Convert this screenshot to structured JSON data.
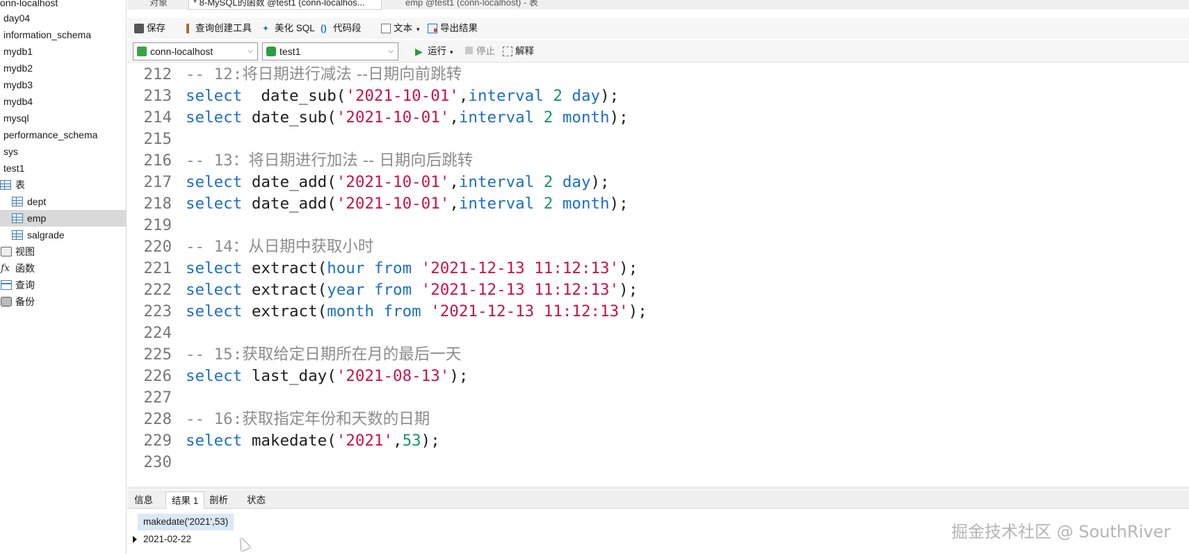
{
  "sidebar": {
    "items": [
      {
        "label": "onn-localhost"
      },
      {
        "label": "day04"
      },
      {
        "label": "information_schema"
      },
      {
        "label": "mydb1"
      },
      {
        "label": "mydb2"
      },
      {
        "label": "mydb3"
      },
      {
        "label": "mydb4"
      },
      {
        "label": "mysql"
      },
      {
        "label": "performance_schema"
      },
      {
        "label": "sys"
      },
      {
        "label": "test1"
      },
      {
        "label": "表"
      },
      {
        "label": "dept"
      },
      {
        "label": "emp"
      },
      {
        "label": "salgrade"
      },
      {
        "label": "视图"
      },
      {
        "label": "函数"
      },
      {
        "label": "查询"
      },
      {
        "label": "备份"
      }
    ]
  },
  "tabs": [
    {
      "label": "对象"
    },
    {
      "label": "* 8-MySQL的函数 @test1 (conn-localhos..."
    },
    {
      "label": "emp @test1 (conn-localhost) - 表"
    }
  ],
  "toolbar": {
    "save": "保存",
    "query_builder": "查询创建工具",
    "beautify": "美化 SQL",
    "snippet": "代码段",
    "text": "文本",
    "export": "导出结果"
  },
  "connbar": {
    "connection": "conn-localhost",
    "database": "test1",
    "run": "运行",
    "stop": "停止",
    "explain": "解释"
  },
  "editor": {
    "lines": [
      {
        "n": "212",
        "parts": [
          [
            "cm",
            "-- 12:"
          ],
          [
            "cmcn",
            "将日期进行减法 --日期向前跳转"
          ]
        ]
      },
      {
        "n": "213",
        "parts": [
          [
            "kw",
            "select"
          ],
          [
            "",
            "  date_sub("
          ],
          [
            "str",
            "'2021-10-01'"
          ],
          [
            "",
            ","
          ],
          [
            "kw",
            "interval"
          ],
          [
            "",
            " "
          ],
          [
            "num",
            "2"
          ],
          [
            "",
            " "
          ],
          [
            "kw",
            "day"
          ],
          [
            "",
            ");"
          ]
        ]
      },
      {
        "n": "214",
        "parts": [
          [
            "kw",
            "select"
          ],
          [
            "",
            " date_sub("
          ],
          [
            "str",
            "'2021-10-01'"
          ],
          [
            "",
            ","
          ],
          [
            "kw",
            "interval"
          ],
          [
            "",
            " "
          ],
          [
            "num",
            "2"
          ],
          [
            "",
            " "
          ],
          [
            "kw",
            "month"
          ],
          [
            "",
            ");"
          ]
        ]
      },
      {
        "n": "215",
        "parts": []
      },
      {
        "n": "216",
        "parts": [
          [
            "cm",
            "-- 13："
          ],
          [
            "cmcn",
            "将日期进行加法 -- 日期向后跳转"
          ]
        ]
      },
      {
        "n": "217",
        "parts": [
          [
            "kw",
            "select"
          ],
          [
            "",
            " date_add("
          ],
          [
            "str",
            "'2021-10-01'"
          ],
          [
            "",
            ","
          ],
          [
            "kw",
            "interval"
          ],
          [
            "",
            " "
          ],
          [
            "num",
            "2"
          ],
          [
            "",
            " "
          ],
          [
            "kw",
            "day"
          ],
          [
            "",
            ");"
          ]
        ]
      },
      {
        "n": "218",
        "parts": [
          [
            "kw",
            "select"
          ],
          [
            "",
            " date_add("
          ],
          [
            "str",
            "'2021-10-01'"
          ],
          [
            "",
            ","
          ],
          [
            "kw",
            "interval"
          ],
          [
            "",
            " "
          ],
          [
            "num",
            "2"
          ],
          [
            "",
            " "
          ],
          [
            "kw",
            "month"
          ],
          [
            "",
            ");"
          ]
        ]
      },
      {
        "n": "219",
        "parts": []
      },
      {
        "n": "220",
        "parts": [
          [
            "cm",
            "-- 14："
          ],
          [
            "cmcn",
            "从日期中获取小时"
          ]
        ]
      },
      {
        "n": "221",
        "parts": [
          [
            "kw",
            "select"
          ],
          [
            "",
            " extract("
          ],
          [
            "kw",
            "hour"
          ],
          [
            "",
            " "
          ],
          [
            "kw",
            "from"
          ],
          [
            "",
            " "
          ],
          [
            "str",
            "'2021-12-13 11:12:13'"
          ],
          [
            "",
            ");"
          ]
        ]
      },
      {
        "n": "222",
        "parts": [
          [
            "kw",
            "select"
          ],
          [
            "",
            " extract("
          ],
          [
            "kw",
            "year"
          ],
          [
            "",
            " "
          ],
          [
            "kw",
            "from"
          ],
          [
            "",
            " "
          ],
          [
            "str",
            "'2021-12-13 11:12:13'"
          ],
          [
            "",
            ");"
          ]
        ]
      },
      {
        "n": "223",
        "parts": [
          [
            "kw",
            "select"
          ],
          [
            "",
            " extract("
          ],
          [
            "kw",
            "month"
          ],
          [
            "",
            " "
          ],
          [
            "kw",
            "from"
          ],
          [
            "",
            " "
          ],
          [
            "str",
            "'2021-12-13 11:12:13'"
          ],
          [
            "",
            ");"
          ]
        ]
      },
      {
        "n": "224",
        "parts": []
      },
      {
        "n": "225",
        "parts": [
          [
            "cm",
            "-- 15:"
          ],
          [
            "cmcn",
            "获取给定日期所在月的最后一天"
          ]
        ]
      },
      {
        "n": "226",
        "parts": [
          [
            "kw",
            "select"
          ],
          [
            "",
            " last_day("
          ],
          [
            "str",
            "'2021-08-13'"
          ],
          [
            "",
            ");"
          ]
        ]
      },
      {
        "n": "227",
        "parts": []
      },
      {
        "n": "228",
        "parts": [
          [
            "cm",
            "-- 16:"
          ],
          [
            "cmcn",
            "获取指定年份和天数的日期"
          ]
        ]
      },
      {
        "n": "229",
        "parts": [
          [
            "kw",
            "select"
          ],
          [
            "",
            " makedate("
          ],
          [
            "str",
            "'2021'"
          ],
          [
            "",
            ","
          ],
          [
            "num",
            "53"
          ],
          [
            "",
            ");"
          ]
        ]
      },
      {
        "n": "230",
        "parts": []
      }
    ]
  },
  "bottom_tabs": [
    {
      "label": "信息"
    },
    {
      "label": "结果 1"
    },
    {
      "label": "剖析"
    },
    {
      "label": "状态"
    }
  ],
  "results": {
    "column": "makedate('2021',53)",
    "value": "2021-02-22"
  },
  "watermark": "掘金技术社区 @ SouthRiver"
}
